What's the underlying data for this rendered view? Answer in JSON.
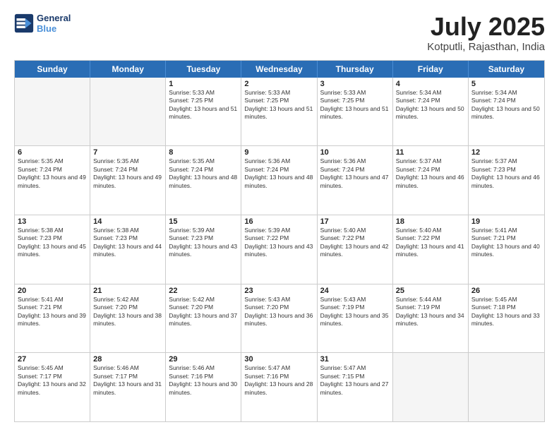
{
  "logo": {
    "line1": "General",
    "line2": "Blue"
  },
  "title": "July 2025",
  "subtitle": "Kotputli, Rajasthan, India",
  "header_days": [
    "Sunday",
    "Monday",
    "Tuesday",
    "Wednesday",
    "Thursday",
    "Friday",
    "Saturday"
  ],
  "weeks": [
    [
      {
        "day": "",
        "empty": true
      },
      {
        "day": "",
        "empty": true
      },
      {
        "day": "1",
        "sunrise": "Sunrise: 5:33 AM",
        "sunset": "Sunset: 7:25 PM",
        "daylight": "Daylight: 13 hours and 51 minutes."
      },
      {
        "day": "2",
        "sunrise": "Sunrise: 5:33 AM",
        "sunset": "Sunset: 7:25 PM",
        "daylight": "Daylight: 13 hours and 51 minutes."
      },
      {
        "day": "3",
        "sunrise": "Sunrise: 5:33 AM",
        "sunset": "Sunset: 7:25 PM",
        "daylight": "Daylight: 13 hours and 51 minutes."
      },
      {
        "day": "4",
        "sunrise": "Sunrise: 5:34 AM",
        "sunset": "Sunset: 7:24 PM",
        "daylight": "Daylight: 13 hours and 50 minutes."
      },
      {
        "day": "5",
        "sunrise": "Sunrise: 5:34 AM",
        "sunset": "Sunset: 7:24 PM",
        "daylight": "Daylight: 13 hours and 50 minutes."
      }
    ],
    [
      {
        "day": "6",
        "sunrise": "Sunrise: 5:35 AM",
        "sunset": "Sunset: 7:24 PM",
        "daylight": "Daylight: 13 hours and 49 minutes."
      },
      {
        "day": "7",
        "sunrise": "Sunrise: 5:35 AM",
        "sunset": "Sunset: 7:24 PM",
        "daylight": "Daylight: 13 hours and 49 minutes."
      },
      {
        "day": "8",
        "sunrise": "Sunrise: 5:35 AM",
        "sunset": "Sunset: 7:24 PM",
        "daylight": "Daylight: 13 hours and 48 minutes."
      },
      {
        "day": "9",
        "sunrise": "Sunrise: 5:36 AM",
        "sunset": "Sunset: 7:24 PM",
        "daylight": "Daylight: 13 hours and 48 minutes."
      },
      {
        "day": "10",
        "sunrise": "Sunrise: 5:36 AM",
        "sunset": "Sunset: 7:24 PM",
        "daylight": "Daylight: 13 hours and 47 minutes."
      },
      {
        "day": "11",
        "sunrise": "Sunrise: 5:37 AM",
        "sunset": "Sunset: 7:24 PM",
        "daylight": "Daylight: 13 hours and 46 minutes."
      },
      {
        "day": "12",
        "sunrise": "Sunrise: 5:37 AM",
        "sunset": "Sunset: 7:23 PM",
        "daylight": "Daylight: 13 hours and 46 minutes."
      }
    ],
    [
      {
        "day": "13",
        "sunrise": "Sunrise: 5:38 AM",
        "sunset": "Sunset: 7:23 PM",
        "daylight": "Daylight: 13 hours and 45 minutes."
      },
      {
        "day": "14",
        "sunrise": "Sunrise: 5:38 AM",
        "sunset": "Sunset: 7:23 PM",
        "daylight": "Daylight: 13 hours and 44 minutes."
      },
      {
        "day": "15",
        "sunrise": "Sunrise: 5:39 AM",
        "sunset": "Sunset: 7:23 PM",
        "daylight": "Daylight: 13 hours and 43 minutes."
      },
      {
        "day": "16",
        "sunrise": "Sunrise: 5:39 AM",
        "sunset": "Sunset: 7:22 PM",
        "daylight": "Daylight: 13 hours and 43 minutes."
      },
      {
        "day": "17",
        "sunrise": "Sunrise: 5:40 AM",
        "sunset": "Sunset: 7:22 PM",
        "daylight": "Daylight: 13 hours and 42 minutes."
      },
      {
        "day": "18",
        "sunrise": "Sunrise: 5:40 AM",
        "sunset": "Sunset: 7:22 PM",
        "daylight": "Daylight: 13 hours and 41 minutes."
      },
      {
        "day": "19",
        "sunrise": "Sunrise: 5:41 AM",
        "sunset": "Sunset: 7:21 PM",
        "daylight": "Daylight: 13 hours and 40 minutes."
      }
    ],
    [
      {
        "day": "20",
        "sunrise": "Sunrise: 5:41 AM",
        "sunset": "Sunset: 7:21 PM",
        "daylight": "Daylight: 13 hours and 39 minutes."
      },
      {
        "day": "21",
        "sunrise": "Sunrise: 5:42 AM",
        "sunset": "Sunset: 7:20 PM",
        "daylight": "Daylight: 13 hours and 38 minutes."
      },
      {
        "day": "22",
        "sunrise": "Sunrise: 5:42 AM",
        "sunset": "Sunset: 7:20 PM",
        "daylight": "Daylight: 13 hours and 37 minutes."
      },
      {
        "day": "23",
        "sunrise": "Sunrise: 5:43 AM",
        "sunset": "Sunset: 7:20 PM",
        "daylight": "Daylight: 13 hours and 36 minutes."
      },
      {
        "day": "24",
        "sunrise": "Sunrise: 5:43 AM",
        "sunset": "Sunset: 7:19 PM",
        "daylight": "Daylight: 13 hours and 35 minutes."
      },
      {
        "day": "25",
        "sunrise": "Sunrise: 5:44 AM",
        "sunset": "Sunset: 7:19 PM",
        "daylight": "Daylight: 13 hours and 34 minutes."
      },
      {
        "day": "26",
        "sunrise": "Sunrise: 5:45 AM",
        "sunset": "Sunset: 7:18 PM",
        "daylight": "Daylight: 13 hours and 33 minutes."
      }
    ],
    [
      {
        "day": "27",
        "sunrise": "Sunrise: 5:45 AM",
        "sunset": "Sunset: 7:17 PM",
        "daylight": "Daylight: 13 hours and 32 minutes."
      },
      {
        "day": "28",
        "sunrise": "Sunrise: 5:46 AM",
        "sunset": "Sunset: 7:17 PM",
        "daylight": "Daylight: 13 hours and 31 minutes."
      },
      {
        "day": "29",
        "sunrise": "Sunrise: 5:46 AM",
        "sunset": "Sunset: 7:16 PM",
        "daylight": "Daylight: 13 hours and 30 minutes."
      },
      {
        "day": "30",
        "sunrise": "Sunrise: 5:47 AM",
        "sunset": "Sunset: 7:16 PM",
        "daylight": "Daylight: 13 hours and 28 minutes."
      },
      {
        "day": "31",
        "sunrise": "Sunrise: 5:47 AM",
        "sunset": "Sunset: 7:15 PM",
        "daylight": "Daylight: 13 hours and 27 minutes."
      },
      {
        "day": "",
        "empty": true
      },
      {
        "day": "",
        "empty": true
      }
    ]
  ]
}
